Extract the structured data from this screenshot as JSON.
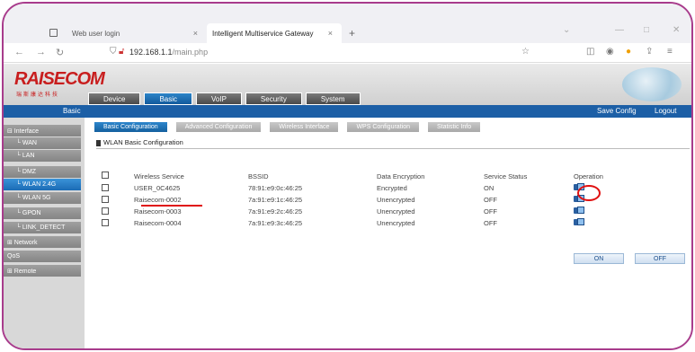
{
  "browser": {
    "tabs": [
      {
        "label": "Web user login"
      },
      {
        "label": "Intelligent Multiservice Gateway"
      }
    ],
    "new_tab": "+",
    "close_glyph": "×",
    "url_host": "192.168.1.1",
    "url_path": "/main.php"
  },
  "logo": {
    "text": "RAISECOM",
    "sub": "瑞斯康达科技"
  },
  "menu": [
    {
      "label": "Device",
      "active": false
    },
    {
      "label": "Basic",
      "active": true
    },
    {
      "label": "VoIP",
      "active": false
    },
    {
      "label": "Security",
      "active": false
    },
    {
      "label": "System",
      "active": false
    }
  ],
  "bluebar": {
    "section": "Basic",
    "save": "Save Config",
    "logout": "Logout"
  },
  "sidebar": [
    {
      "label": "⊟ Interface",
      "sub": false,
      "active": false
    },
    {
      "label": "└ WAN",
      "sub": true,
      "active": false
    },
    {
      "label": "└ LAN",
      "sub": true,
      "active": false
    },
    {
      "label": "└ DMZ",
      "sub": true,
      "active": false
    },
    {
      "label": "└ WLAN 2.4G",
      "sub": true,
      "active": true
    },
    {
      "label": "└ WLAN 5G",
      "sub": true,
      "active": false
    },
    {
      "label": "└ GPON",
      "sub": true,
      "active": false
    },
    {
      "label": "└ LINK_DETECT",
      "sub": true,
      "active": false
    },
    {
      "label": "⊞ Network",
      "sub": false,
      "active": false
    },
    {
      "label": "QoS",
      "sub": false,
      "active": false
    },
    {
      "label": "⊞ Remote",
      "sub": false,
      "active": false
    }
  ],
  "subtabs": [
    {
      "label": "Basic Configuration",
      "active": true
    },
    {
      "label": "Advanced Configuration",
      "active": false
    },
    {
      "label": "Wireless Interface",
      "active": false
    },
    {
      "label": "WPS Configuration",
      "active": false
    },
    {
      "label": "Statistic Info",
      "active": false
    }
  ],
  "section_title": "WLAN Basic Configuration",
  "table": {
    "headers": [
      "Wireless Service",
      "BSSID",
      "Data Encryption",
      "Service Status",
      "Operation"
    ],
    "rows": [
      {
        "service": "USER_0C4625",
        "bssid": "78:91:e9:0c:46:25",
        "encryption": "Encrypted",
        "status": "ON"
      },
      {
        "service": "Raisecom-0002",
        "bssid": "7a:91:e9:1c:46:25",
        "encryption": "Unencrypted",
        "status": "OFF"
      },
      {
        "service": "Raisecom-0003",
        "bssid": "7a:91:e9:2c:46:25",
        "encryption": "Unencrypted",
        "status": "OFF"
      },
      {
        "service": "Raisecom-0004",
        "bssid": "7a:91:e9:3c:46:25",
        "encryption": "Unencrypted",
        "status": "OFF"
      }
    ]
  },
  "buttons": {
    "on": "ON",
    "off": "OFF"
  }
}
